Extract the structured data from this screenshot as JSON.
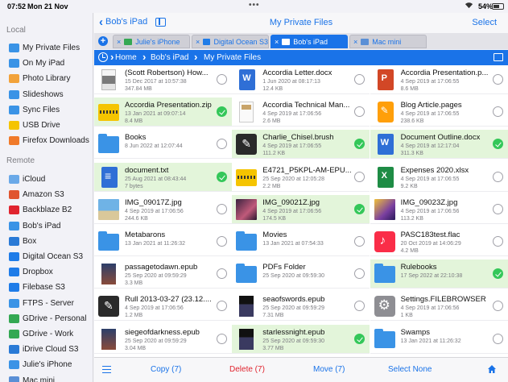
{
  "status": {
    "time": "07:52",
    "date": "Mon 21 Nov",
    "battery": "54%"
  },
  "sidebar": {
    "local_title": "Local",
    "local_items": [
      {
        "label": "My Private Files",
        "icon": "folder-icon"
      },
      {
        "label": "On My iPad",
        "icon": "folder-icon"
      },
      {
        "label": "Photo Library",
        "icon": "photos-icon"
      },
      {
        "label": "Slideshows",
        "icon": "folder-icon"
      },
      {
        "label": "Sync Files",
        "icon": "folder-icon"
      },
      {
        "label": "USB Drive",
        "icon": "usb-icon"
      },
      {
        "label": "Firefox Downloads",
        "icon": "firefox-icon"
      }
    ],
    "remote_title": "Remote",
    "remote_items": [
      {
        "label": "iCloud",
        "icon": "cloud-icon"
      },
      {
        "label": "Amazon S3",
        "icon": "amazon-s3-icon"
      },
      {
        "label": "Backblaze B2",
        "icon": "backblaze-icon"
      },
      {
        "label": "Bob's iPad",
        "icon": "ipad-icon"
      },
      {
        "label": "Box",
        "icon": "box-icon"
      },
      {
        "label": "Digital Ocean S3",
        "icon": "digital-ocean-icon"
      },
      {
        "label": "Dropbox",
        "icon": "dropbox-icon"
      },
      {
        "label": "Filebase S3",
        "icon": "filebase-icon"
      },
      {
        "label": "FTPS - Server",
        "icon": "ftp-icon"
      },
      {
        "label": "GDrive - Personal",
        "icon": "gdrive-icon"
      },
      {
        "label": "GDrive - Work",
        "icon": "gdrive-icon"
      },
      {
        "label": "iDrive Cloud S3",
        "icon": "idrive-icon"
      },
      {
        "label": "Julie's iPhone",
        "icon": "iphone-icon"
      },
      {
        "label": "Mac mini",
        "icon": "mac-icon"
      }
    ]
  },
  "header": {
    "back_label": "Bob's iPad",
    "title": "My Private Files",
    "select_label": "Select"
  },
  "tabs": [
    {
      "label": "Julie's iPhone",
      "active": false
    },
    {
      "label": "Digital Ocean S3",
      "active": false
    },
    {
      "label": "Bob's iPad",
      "active": true
    },
    {
      "label": "Mac mini",
      "active": false
    }
  ],
  "breadcrumb": [
    "Home",
    "Bob's iPad",
    "My Private Files"
  ],
  "files": [
    [
      {
        "name": "(Scott Robertson) How...",
        "meta1": "15 Dec 2017 at 10:57:38",
        "meta2": "347.84 MB",
        "thumb": "book",
        "selected": false
      },
      {
        "name": "Accordia Letter.docx",
        "meta1": "1 Jun 2020 at 08:17:13",
        "meta2": "12.4 KB",
        "thumb": "doc",
        "selected": false
      },
      {
        "name": "Accordia Presentation.p...",
        "meta1": "4 Sep 2019 at 17:06:55",
        "meta2": "8.6 MB",
        "thumb": "ppt",
        "selected": false
      }
    ],
    [
      {
        "name": "Accordia Presentation.zip",
        "meta1": "13 Jan 2021 at 09:07:14",
        "meta2": "8.4 MB",
        "thumb": "zip",
        "selected": true
      },
      {
        "name": "Accordia Technical Man...",
        "meta1": "4 Sep 2019 at 17:06:56",
        "meta2": "2.6 MB",
        "thumb": "zipdoc",
        "selected": false
      },
      {
        "name": "Blog Article.pages",
        "meta1": "4 Sep 2019 at 17:06:55",
        "meta2": "238.6 KB",
        "thumb": "pages",
        "selected": false
      }
    ],
    [
      {
        "name": "Books",
        "meta1": "8 Jun 2022 at 12:07:44",
        "meta2": "",
        "thumb": "folder",
        "selected": false
      },
      {
        "name": "Charlie_Chisel.brush",
        "meta1": "4 Sep 2019 at 17:06:55",
        "meta2": "111.2 KB",
        "thumb": "brush",
        "selected": true
      },
      {
        "name": "Document Outline.docx",
        "meta1": "4 Sep 2019 at 12:17:04",
        "meta2": "311.3 KB",
        "thumb": "doc",
        "selected": true
      }
    ],
    [
      {
        "name": "document.txt",
        "meta1": "25 Aug 2021 at 08:43:44",
        "meta2": "7 bytes",
        "thumb": "txt",
        "selected": true
      },
      {
        "name": "E4721_P5KPL-AM-EPU...",
        "meta1": "25 Sep 2020 at 12:05:28",
        "meta2": "2.2 MB",
        "thumb": "zip",
        "selected": false
      },
      {
        "name": "Expenses 2020.xlsx",
        "meta1": "4 Sep 2019 at 17:06:55",
        "meta2": "9.2 KB",
        "thumb": "xls",
        "selected": false
      }
    ],
    [
      {
        "name": "IMG_09017Z.jpg",
        "meta1": "4 Sep 2019 at 17:06:56",
        "meta2": "244.6 KB",
        "thumb": "pic",
        "selected": false
      },
      {
        "name": "IMG_09021Z.jpg",
        "meta1": "4 Sep 2019 at 17:06:56",
        "meta2": "174.5 KB",
        "thumb": "pic2",
        "selected": true
      },
      {
        "name": "IMG_09023Z.jpg",
        "meta1": "4 Sep 2019 at 17:06:56",
        "meta2": "113.2 KB",
        "thumb": "pic3",
        "selected": false
      }
    ],
    [
      {
        "name": "Metabarons",
        "meta1": "13 Jan 2021 at 11:26:32",
        "meta2": "",
        "thumb": "folder",
        "selected": false
      },
      {
        "name": "Movies",
        "meta1": "13 Jan 2021 at 07:54:33",
        "meta2": "",
        "thumb": "folder",
        "selected": false
      },
      {
        "name": "PASC183test.flac",
        "meta1": "20 Oct 2019 at 14:06:29",
        "meta2": "4.2 MB",
        "thumb": "music",
        "selected": false
      }
    ],
    [
      {
        "name": "passagetodawn.epub",
        "meta1": "25 Sep 2020 at 09:59:29",
        "meta2": "3.3 MB",
        "thumb": "book2",
        "selected": false
      },
      {
        "name": "PDFs Folder",
        "meta1": "25 Sep 2020 at 09:59:30",
        "meta2": "",
        "thumb": "folder",
        "selected": false
      },
      {
        "name": "Rulebooks",
        "meta1": "17 Sep 2022 at 22:10:38",
        "meta2": "",
        "thumb": "folder",
        "selected": true
      }
    ],
    [
      {
        "name": "Rull 2013-03-27 (23.12....",
        "meta1": "4 Sep 2019 at 17:06:56",
        "meta2": "1.2 MB",
        "thumb": "brush",
        "selected": false
      },
      {
        "name": "seaofswords.epub",
        "meta1": "25 Sep 2020 at 09:59:29",
        "meta2": "7.31 MB",
        "thumb": "book3",
        "selected": false
      },
      {
        "name": "Settings.FILEBROWSER",
        "meta1": "4 Sep 2019 at 17:06:56",
        "meta2": "1 KB",
        "thumb": "gear",
        "selected": false
      }
    ],
    [
      {
        "name": "siegeofdarkness.epub",
        "meta1": "25 Sep 2020 at 09:59:29",
        "meta2": "3.04 MB",
        "thumb": "book2",
        "selected": false
      },
      {
        "name": "starlessnight.epub",
        "meta1": "25 Sep 2020 at 09:59:30",
        "meta2": "3.77 MB",
        "thumb": "book3",
        "selected": true
      },
      {
        "name": "Swamps",
        "meta1": "13 Jan 2021 at 11:26:32",
        "meta2": "",
        "thumb": "folder",
        "selected": false
      }
    ]
  ],
  "toolbar": {
    "copy": "Copy (7)",
    "delete": "Delete (7)",
    "move": "Move (7)",
    "select_none": "Select None"
  },
  "colors": {
    "accent": "#1a73e8",
    "selected_bg": "#e3f5da",
    "check_green": "#34c759",
    "delete_red": "#e0242f"
  }
}
